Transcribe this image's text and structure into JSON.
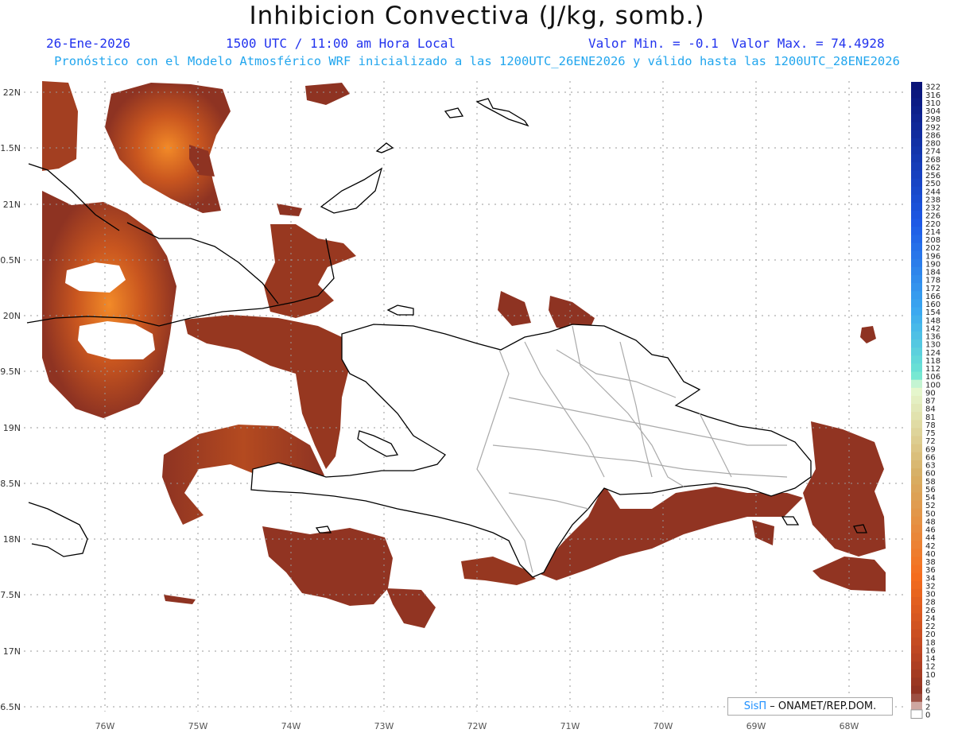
{
  "header": {
    "title": "Inhibicion Convectiva (J/kg, somb.)",
    "date": "26-Ene-2026",
    "time": "1500 UTC / 11:00 am Hora Local",
    "min": "Valor Min. = -0.1",
    "max": "Valor Max. = 74.4928",
    "subtitle": "Pronóstico con el Modelo Atmosférico WRF inicializado a las 1200UTC_26ENE2026 y válido hasta las  1200UTC_28ENE2026"
  },
  "axes": {
    "lat_labels": [
      "22N",
      "1.5N",
      "21N",
      "0.5N",
      "20N",
      "9.5N",
      "19N",
      "8.5N",
      "18N",
      "7.5N",
      "17N",
      "6.5N"
    ],
    "lon_labels": [
      "76W",
      "75W",
      "74W",
      "73W",
      "72W",
      "71W",
      "70W",
      "69W",
      "68W"
    ]
  },
  "colorbar": {
    "labels": [
      "322",
      "316",
      "310",
      "304",
      "298",
      "292",
      "286",
      "280",
      "274",
      "268",
      "262",
      "256",
      "250",
      "244",
      "238",
      "232",
      "226",
      "220",
      "214",
      "208",
      "202",
      "196",
      "190",
      "184",
      "178",
      "172",
      "166",
      "160",
      "154",
      "148",
      "142",
      "136",
      "130",
      "124",
      "118",
      "112",
      "106",
      "100",
      "90",
      "87",
      "84",
      "81",
      "78",
      "75",
      "72",
      "69",
      "66",
      "63",
      "60",
      "58",
      "56",
      "54",
      "52",
      "50",
      "48",
      "46",
      "44",
      "42",
      "40",
      "38",
      "36",
      "34",
      "32",
      "30",
      "28",
      "26",
      "24",
      "22",
      "20",
      "18",
      "16",
      "14",
      "12",
      "10",
      "8",
      "6",
      "4",
      "2",
      "0"
    ]
  },
  "credit": {
    "brand": "SisΠ",
    "text": "– ONAMET/REP.DOM."
  },
  "colors": {
    "field_base": "#8e3322",
    "field_warm": "#b94a1f",
    "field_hot": "#f07a22",
    "coast": "#000000",
    "province_border": "#aaaaaa",
    "grid": "#999999",
    "header_blue": "#2233ee",
    "header_cyan": "#22a6ee"
  }
}
